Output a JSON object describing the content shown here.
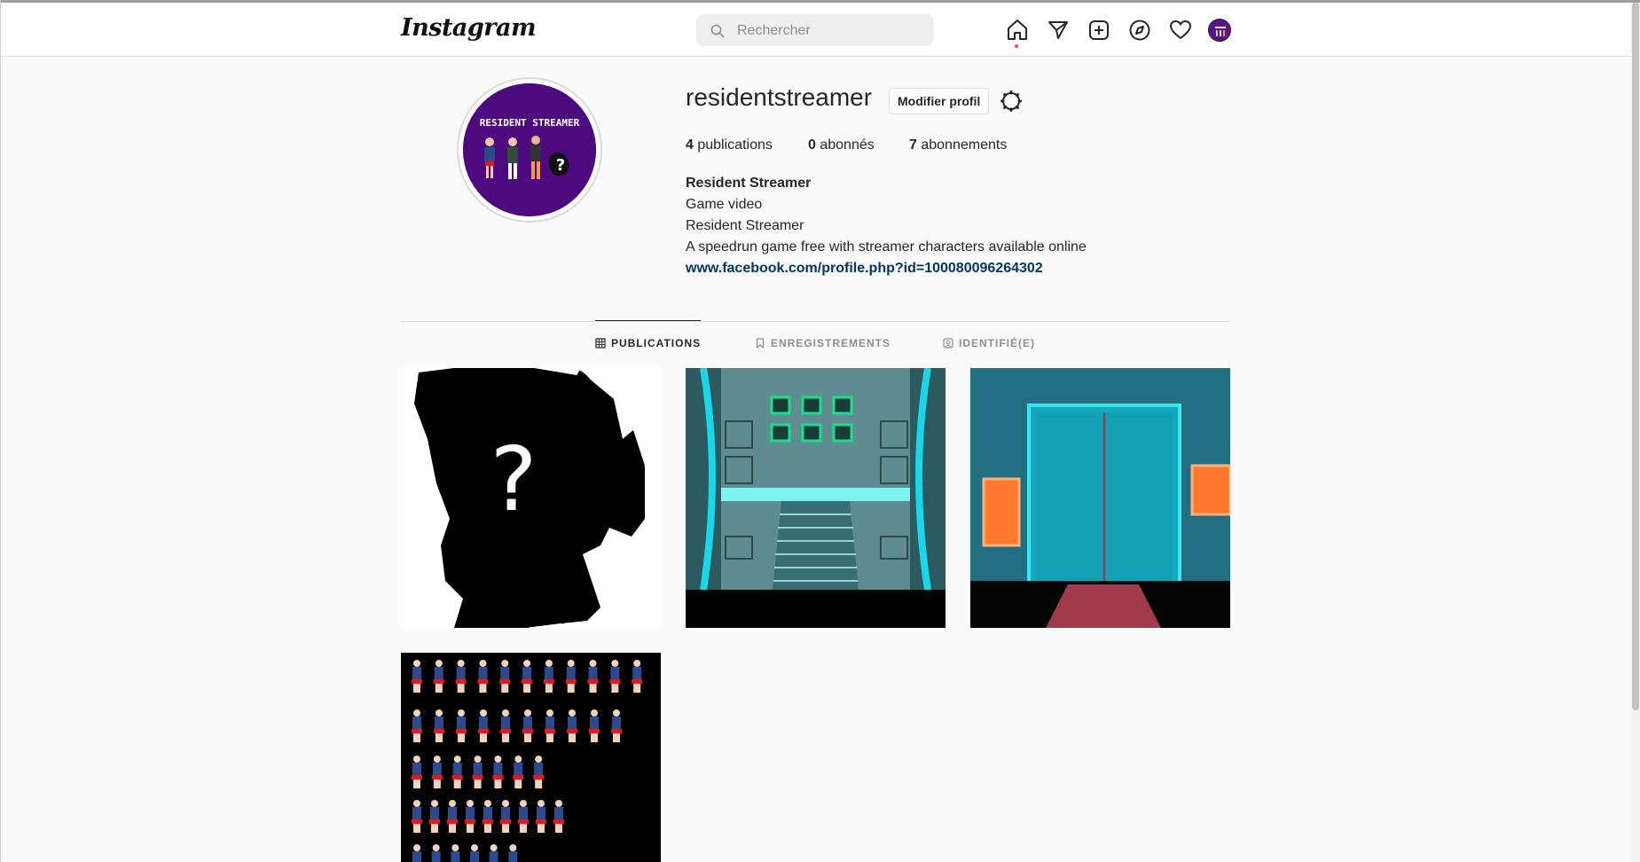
{
  "header": {
    "logo_text": "Instagram",
    "search_placeholder": "Rechercher",
    "icons": [
      "home-icon",
      "direct-icon",
      "new-post-icon",
      "explore-icon",
      "activity-icon",
      "profile-avatar"
    ]
  },
  "profile": {
    "username": "residentstreamer",
    "edit_button": "Modifier profil",
    "stats": {
      "posts_count": "4",
      "posts_label": "publications",
      "followers_count": "0",
      "followers_label": "abonnés",
      "following_count": "7",
      "following_label": "abonnements"
    },
    "bio": {
      "name": "Resident Streamer",
      "category": "Game video",
      "line1": "Resident Streamer",
      "line2": "A speedrun game free with streamer characters available online",
      "link": "www.facebook.com/profile.php?id=100080096264302"
    },
    "avatar_text": "RESIDENT STREAMER"
  },
  "tabs": [
    {
      "label": "PUBLICATIONS",
      "active": true
    },
    {
      "label": "ENREGISTREMENTS",
      "active": false
    },
    {
      "label": "IDENTIFIÉ(E)",
      "active": false
    }
  ],
  "posts": [
    {
      "name": "silhouette-question-post",
      "overlay_text": "?"
    },
    {
      "name": "space-station-stairs-post"
    },
    {
      "name": "elevator-doors-post"
    },
    {
      "name": "sprite-sheet-post"
    }
  ],
  "colors": {
    "accent_link": "#00376b",
    "notification_dot": "#ed4956",
    "avatar_purple": "#4d0a7e"
  }
}
